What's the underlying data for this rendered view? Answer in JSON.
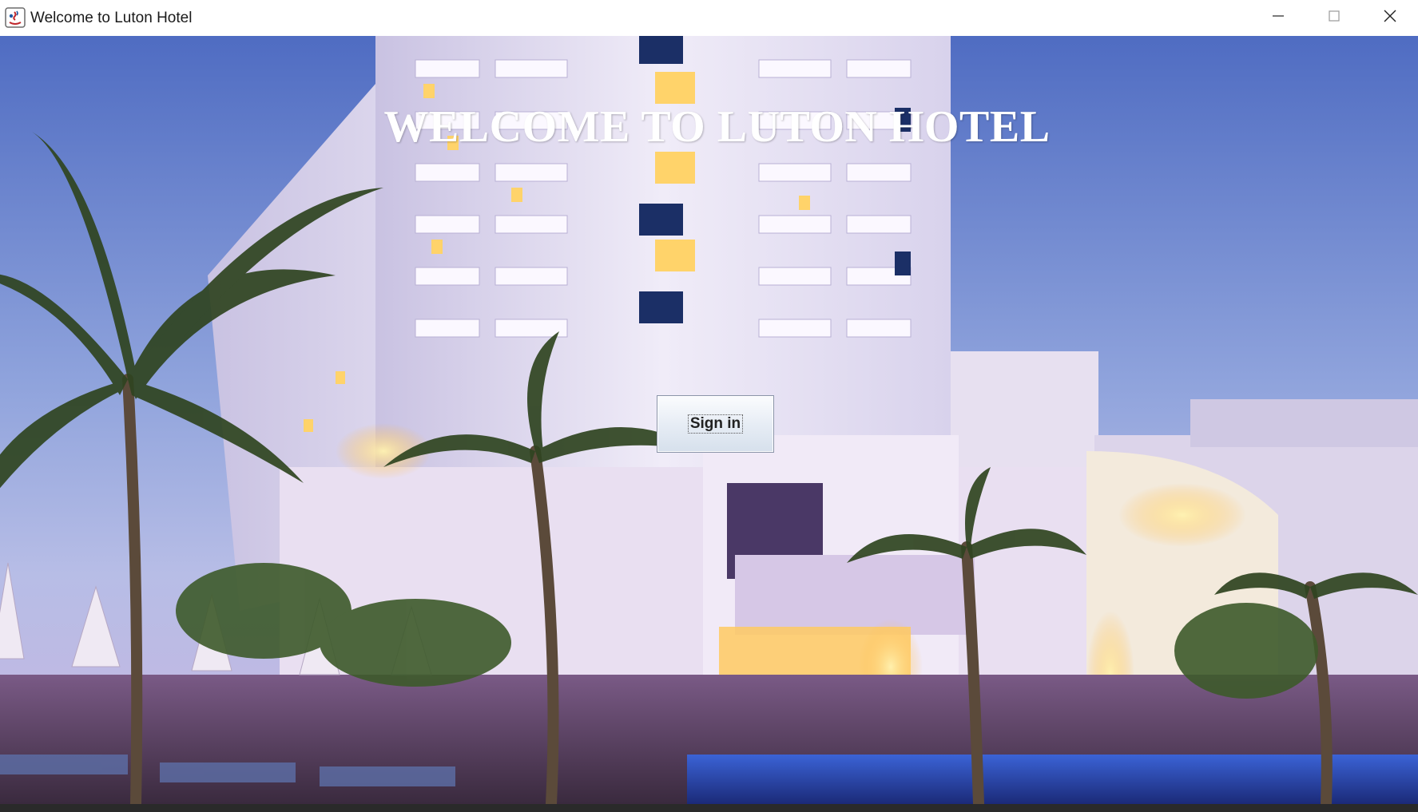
{
  "window": {
    "title": "Welcome to Luton Hotel",
    "icon": "java-app-icon",
    "controls": {
      "minimize": "minimize-icon",
      "maximize": "maximize-icon",
      "close": "close-icon"
    }
  },
  "main": {
    "heading": "WELCOME TO LUTON HOTEL",
    "sign_in_label": "Sign in",
    "background": "hotel-night-photo"
  },
  "colors": {
    "heading": "#ffffff",
    "sky_top": "#5f78c4",
    "building": "#e8e2f2",
    "lights": "#ffcc55"
  }
}
